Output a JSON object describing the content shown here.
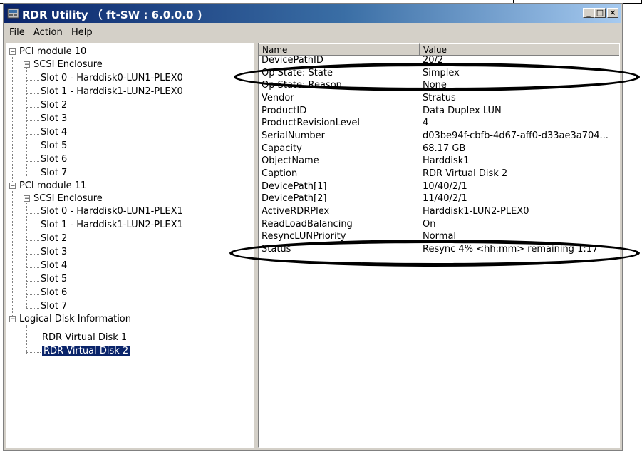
{
  "window": {
    "title": "RDR Utility （ ft-SW : 6.0.0.0 )",
    "buttons": {
      "minimize": "_",
      "maximize": "□",
      "close": "×"
    }
  },
  "menu": [
    {
      "label": "File",
      "mnemonic": "F",
      "rest": "ile"
    },
    {
      "label": "Action",
      "mnemonic": "A",
      "rest": "ction"
    },
    {
      "label": "Help",
      "mnemonic": "H",
      "rest": "elp"
    }
  ],
  "tree": {
    "pci10": {
      "label": "PCI module 10",
      "enclosure": "SCSI Enclosure",
      "slots": [
        "Slot 0  -  Harddisk0-LUN1-PLEX0",
        "Slot 1  -  Harddisk1-LUN2-PLEX0",
        "Slot 2",
        "Slot 3",
        "Slot 4",
        "Slot 5",
        "Slot 6",
        "Slot 7"
      ]
    },
    "pci11": {
      "label": "PCI module 11",
      "enclosure": "SCSI Enclosure",
      "slots": [
        "Slot 0  -  Harddisk0-LUN1-PLEX1",
        "Slot 1  -  Harddisk1-LUN2-PLEX1",
        "Slot 2",
        "Slot 3",
        "Slot 4",
        "Slot 5",
        "Slot 6",
        "Slot 7"
      ]
    },
    "logical": {
      "label": "Logical Disk Information",
      "items": [
        "RDR Virtual Disk 1",
        "RDR Virtual Disk 2"
      ]
    }
  },
  "listview": {
    "columns": {
      "name": "Name",
      "value": "Value"
    },
    "rows": [
      {
        "name": "DevicePathID",
        "value": "20/2"
      },
      {
        "name": "Op State: State",
        "value": "Simplex"
      },
      {
        "name": "Op State: Reason",
        "value": "None"
      },
      {
        "name": "Vendor",
        "value": "Stratus"
      },
      {
        "name": "ProductID",
        "value": "Data Duplex LUN"
      },
      {
        "name": "ProductRevisionLevel",
        "value": "4"
      },
      {
        "name": "SerialNumber",
        "value": "d03be94f-cbfb-4d67-aff0-d33ae3a704..."
      },
      {
        "name": "Capacity",
        "value": "68.17 GB"
      },
      {
        "name": "ObjectName",
        "value": "Harddisk1"
      },
      {
        "name": "Caption",
        "value": "RDR Virtual Disk 2"
      },
      {
        "name": "DevicePath[1]",
        "value": "10/40/2/1"
      },
      {
        "name": "DevicePath[2]",
        "value": "11/40/2/1"
      },
      {
        "name": "ActiveRDRPlex",
        "value": "Harddisk1-LUN2-PLEX0"
      },
      {
        "name": "ReadLoadBalancing",
        "value": "On"
      },
      {
        "name": "ResyncLUNPriority",
        "value": "Normal"
      },
      {
        "name": "Status",
        "value": "Resync 4% <hh:mm> remaining 1:17"
      }
    ]
  }
}
